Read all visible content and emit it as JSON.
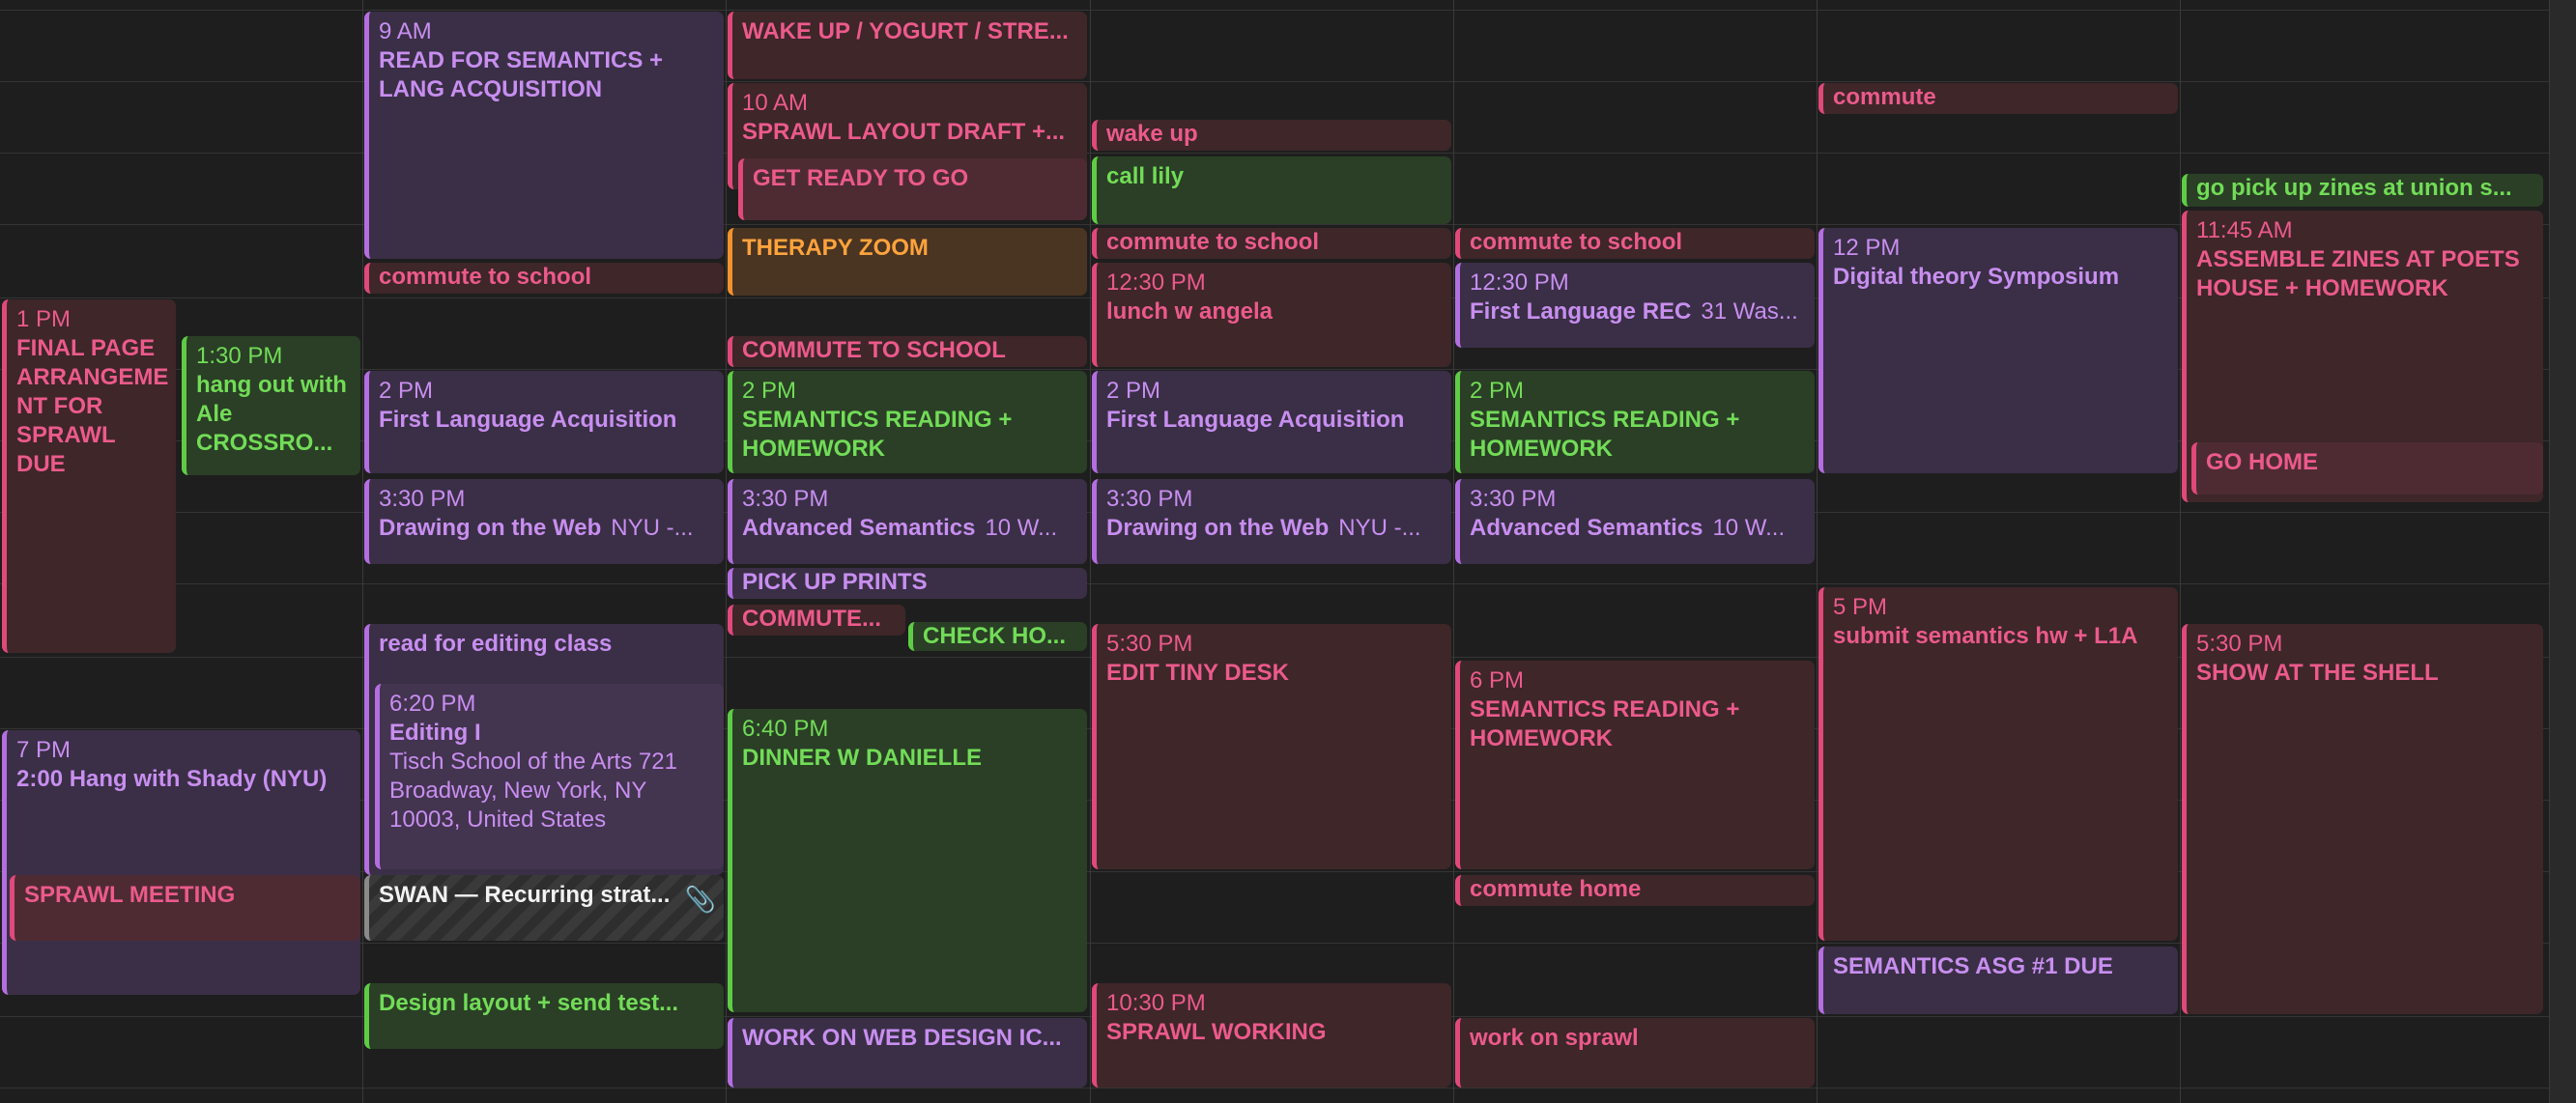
{
  "events": {
    "c0_final": {
      "time": "1 PM",
      "name": "FINAL PAGE ARRANGEME NT FOR SPRAWL DUE"
    },
    "c0_shady": {
      "time": "7 PM",
      "name": "2:00 Hang with Shady (NYU)"
    },
    "c0_sprawl": {
      "name": "SPRAWL MEETING"
    },
    "c0_ale": {
      "time": "1:30 PM",
      "name": "hang out with Ale CROSSRO..."
    },
    "c1_read": {
      "time": "9 AM",
      "name": "READ FOR SEMANTICS + LANG ACQUISITION"
    },
    "c1_commute": {
      "name": "commute to school"
    },
    "c1_fla": {
      "time": "2 PM",
      "name": "First Language Acquisition"
    },
    "c1_draw": {
      "time": "3:30 PM",
      "name": "Drawing on the Web",
      "loc": "NYU -..."
    },
    "c1_readedit": {
      "name": "read for editing class"
    },
    "c1_editing": {
      "time": "6:20 PM",
      "name": "Editing I",
      "loc": "Tisch School of the Arts 721 Broadway, New York, NY 10003, United States"
    },
    "c1_swan": {
      "name": "SWAN — Recurring strat..."
    },
    "c1_design": {
      "name": "Design layout + send test..."
    },
    "c2_wake": {
      "name": "WAKE UP / YOGURT / STRE..."
    },
    "c2_sprawl": {
      "time": "10 AM",
      "name": "SPRAWL LAYOUT DRAFT +..."
    },
    "c2_ready": {
      "name": "GET READY TO GO"
    },
    "c2_therapy": {
      "name": "THERAPY ZOOM"
    },
    "c2_commute": {
      "name": "COMMUTE TO SCHOOL"
    },
    "c2_sem": {
      "time": "2 PM",
      "name": "SEMANTICS READING + HOMEWORK"
    },
    "c2_adv": {
      "time": "3:30 PM",
      "name": "Advanced Semantics",
      "loc": "10 W..."
    },
    "c2_prints": {
      "name": "PICK UP PRINTS"
    },
    "c2_commute2": {
      "name": "COMMUTE..."
    },
    "c2_check": {
      "name": "CHECK HO..."
    },
    "c2_dinner": {
      "time": "6:40 PM",
      "name": "DINNER W DANIELLE"
    },
    "c2_web": {
      "name": "WORK ON WEB DESIGN IC..."
    },
    "c3_wake": {
      "name": "wake up"
    },
    "c3_lily": {
      "name": "call lily"
    },
    "c3_commute": {
      "name": "commute to school"
    },
    "c3_lunch": {
      "time": "12:30 PM",
      "name": "lunch w angela"
    },
    "c3_fla": {
      "time": "2 PM",
      "name": "First Language Acquisition"
    },
    "c3_draw": {
      "time": "3:30 PM",
      "name": "Drawing on the Web",
      "loc": "NYU -..."
    },
    "c3_tiny": {
      "time": "5:30 PM",
      "name": "EDIT TINY DESK"
    },
    "c3_sprawlwork": {
      "time": "10:30 PM",
      "name": "SPRAWL WORKING"
    },
    "c4_commute": {
      "name": "commute to school"
    },
    "c4_flrec": {
      "time": "12:30 PM",
      "name": "First Language REC",
      "loc": "31 Was..."
    },
    "c4_sem": {
      "time": "2 PM",
      "name": "SEMANTICS READING + HOMEWORK"
    },
    "c4_adv": {
      "time": "3:30 PM",
      "name": "Advanced Semantics",
      "loc": "10 W..."
    },
    "c4_sem6": {
      "time": "6 PM",
      "name": "SEMANTICS READING + HOMEWORK"
    },
    "c4_home": {
      "name": "commute home"
    },
    "c4_sprawl": {
      "name": "work on sprawl"
    },
    "c5_commute": {
      "name": "commute"
    },
    "c5_digital": {
      "time": "12 PM",
      "name": "Digital theory Symposium"
    },
    "c5_submit": {
      "time": "5 PM",
      "name": "submit semantics hw + L1A"
    },
    "c5_asg": {
      "name": "SEMANTICS ASG #1 DUE"
    },
    "c6_zines": {
      "name": "go pick up zines at union s..."
    },
    "c6_assemble": {
      "time": "11:45 AM",
      "name": "ASSEMBLE ZINES AT POETS HOUSE + HOMEWORK"
    },
    "c6_gohome": {
      "name": "GO HOME"
    },
    "c6_show": {
      "time": "5:30 PM",
      "name": "SHOW AT THE SHELL"
    }
  },
  "icons": {
    "attachment": "paperclip-icon"
  },
  "colors": {
    "red": "#e0497a",
    "purple": "#b46ee0",
    "green": "#5fcc45",
    "orange": "#f0922e"
  }
}
